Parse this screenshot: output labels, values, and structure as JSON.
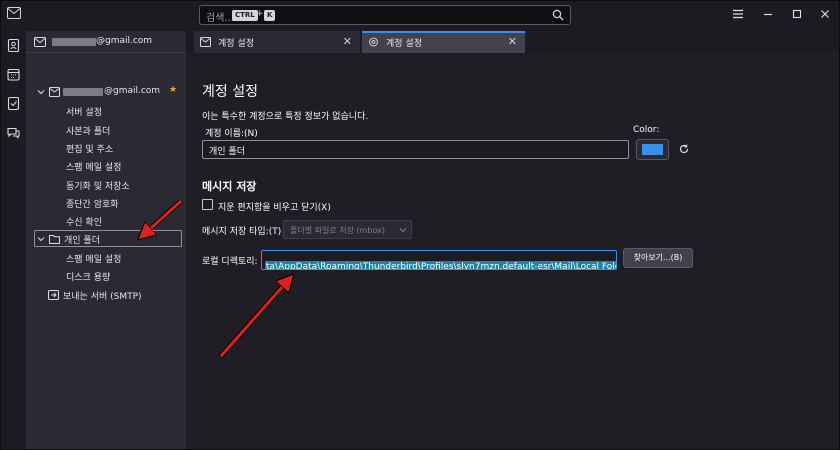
{
  "search": {
    "placeholder": "검색...",
    "shortcut_ctrl": "CTRL",
    "shortcut_plus": "+",
    "shortcut_key": "K"
  },
  "folder_pane": {
    "header_account": "@gmail.com",
    "account_name": "@gmail.com",
    "account_items": [
      "서버 설정",
      "사본과 폴더",
      "편집 및 주소",
      "스팸 메일 설정",
      "동기화 및 저장소",
      "종단간 암호화",
      "수신 확인"
    ],
    "local_folder": "개인 폴더",
    "local_items": [
      "스팸 메일 설정",
      "디스크 용량"
    ],
    "smtp": "보내는 서버 (SMTP)"
  },
  "tabs": [
    {
      "label": "계정 설정"
    },
    {
      "label": "계정 설정"
    }
  ],
  "settings": {
    "title": "계정 설정",
    "notice": "이는 특수한 계정으로 특정 정보가 없습니다.",
    "account_name_label": "계정 이름:(N)",
    "account_name_value": "개인 폴더",
    "color_label": "Color:",
    "color_value": "#3a8fe6",
    "message_storage_heading": "메시지 저장",
    "empty_trash_label": "지운 편지함을 비우고 닫기(X)",
    "store_type_label": "메시지 저장 타입:(T)",
    "store_type_value": "폴더별 파일로 저장 (mbox)",
    "local_dir_label": "로컬 디렉토리:",
    "local_dir_value": "ta\\AppData\\Roaming\\Thunderbird\\Profiles\\slvn7mzn.default-esr\\Mail\\Local Folders",
    "browse_button": "찾아보기...(B)"
  },
  "colors": {
    "accent": "#3a8fe6",
    "star": "#f4a33a",
    "annotation_arrow": "#e0201c"
  }
}
